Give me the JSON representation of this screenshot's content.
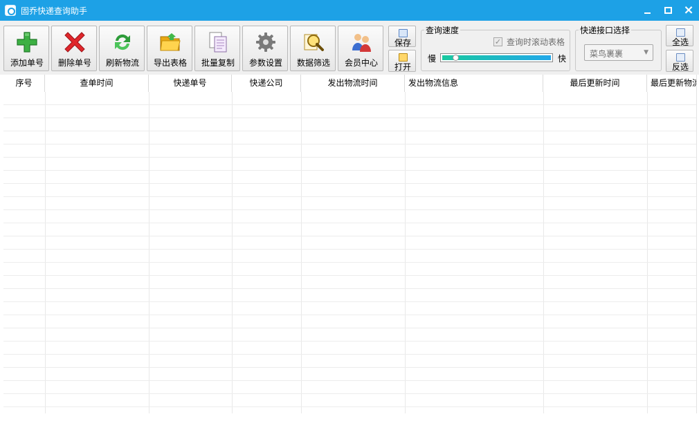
{
  "window": {
    "title": "固乔快递查询助手"
  },
  "toolbar": {
    "buttons": [
      {
        "label": "添加单号"
      },
      {
        "label": "删除单号"
      },
      {
        "label": "刷新物流"
      },
      {
        "label": "导出表格"
      },
      {
        "label": "批量复制"
      },
      {
        "label": "参数设置"
      },
      {
        "label": "数据筛选"
      },
      {
        "label": "会员中心"
      }
    ],
    "save_label": "保存",
    "open_label": "打开",
    "select_all_label": "全选",
    "invert_label": "反选"
  },
  "query_speed": {
    "title": "查询速度",
    "scroll_checkbox_label": "查询时滚动表格",
    "scroll_checked": true,
    "slow_label": "慢",
    "fast_label": "快",
    "speed_fraction": 0.1
  },
  "api_select": {
    "title": "快递接口选择",
    "selected": "菜鸟裹裹"
  },
  "table": {
    "columns": [
      "序号",
      "查单时间",
      "快递单号",
      "快递公司",
      "发出物流时间",
      "发出物流信息",
      "最后更新时间",
      "最后更新物流"
    ],
    "rows": []
  },
  "colors": {
    "title_bar": "#1da1e6",
    "slider_fill": "#19c9a0"
  }
}
